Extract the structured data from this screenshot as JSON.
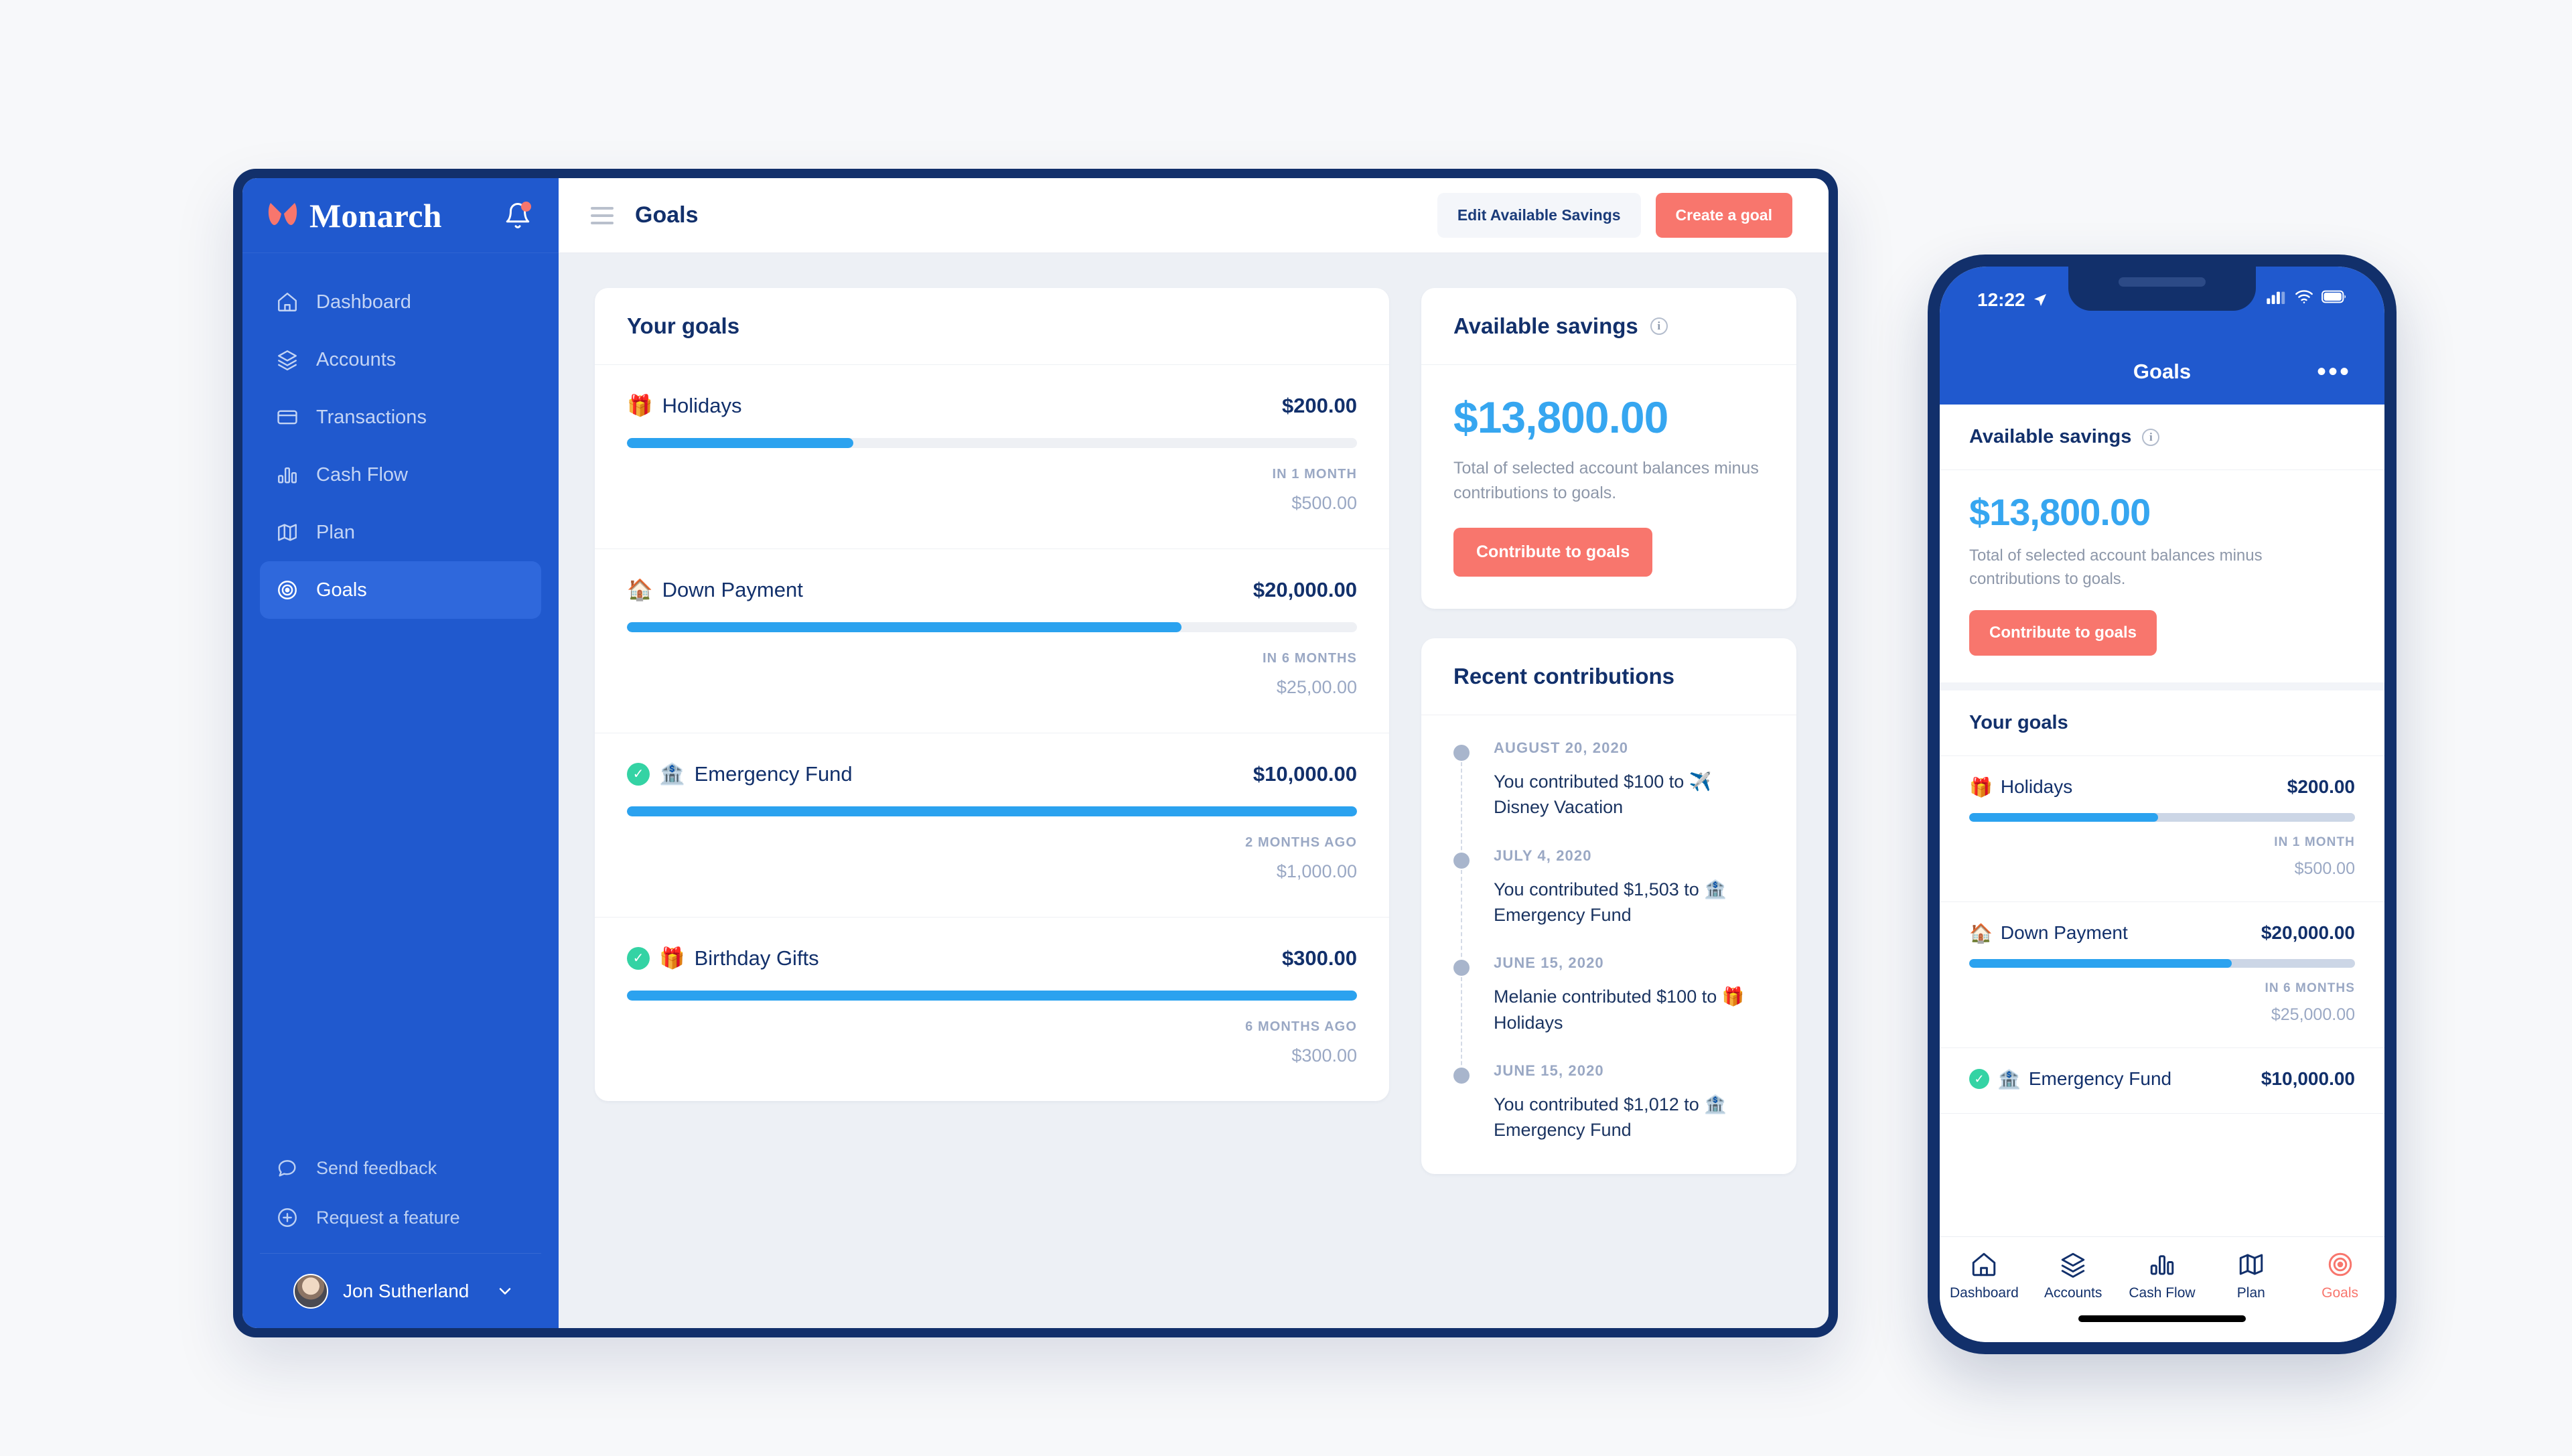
{
  "colors": {
    "brand_blue": "#2059ce",
    "dark_navy": "#12306b",
    "coral": "#f8766d",
    "progress_blue": "#2ba2ef",
    "success_green": "#34d3a4",
    "content_bg": "#edf0f5"
  },
  "sidebar": {
    "brand": "Monarch",
    "nav": [
      {
        "label": "Dashboard",
        "icon": "home-icon",
        "active": false
      },
      {
        "label": "Accounts",
        "icon": "layers-icon",
        "active": false
      },
      {
        "label": "Transactions",
        "icon": "card-icon",
        "active": false
      },
      {
        "label": "Cash Flow",
        "icon": "bar-chart-icon",
        "active": false
      },
      {
        "label": "Plan",
        "icon": "map-icon",
        "active": false
      },
      {
        "label": "Goals",
        "icon": "target-icon",
        "active": true
      }
    ],
    "secondary": [
      {
        "label": "Send feedback",
        "icon": "chat-bubble-icon"
      },
      {
        "label": "Request a feature",
        "icon": "plus-circle-icon"
      }
    ],
    "profile": {
      "name": "Jon Sutherland"
    }
  },
  "topbar": {
    "title": "Goals",
    "edit_savings_label": "Edit Available Savings",
    "create_goal_label": "Create a goal"
  },
  "goals_card": {
    "heading": "Your goals",
    "goals": [
      {
        "emoji": "🎁",
        "name": "Holidays",
        "amount": "$200.00",
        "progress_percent": 31,
        "when": "IN 1 MONTH",
        "target": "$500.00",
        "complete": false
      },
      {
        "emoji": "🏠",
        "name": "Down Payment",
        "amount": "$20,000.00",
        "progress_percent": 76,
        "when": "IN 6 MONTHS",
        "target": "$25,00.00",
        "complete": false
      },
      {
        "emoji": "🏦",
        "name": "Emergency Fund",
        "amount": "$10,000.00",
        "progress_percent": 100,
        "when": "2 MONTHS AGO",
        "target": "$1,000.00",
        "complete": true
      },
      {
        "emoji": "🎁",
        "name": "Birthday Gifts",
        "amount": "$300.00",
        "progress_percent": 100,
        "when": "6 MONTHS AGO",
        "target": "$300.00",
        "complete": true
      }
    ]
  },
  "available_savings": {
    "heading": "Available savings",
    "info_icon": "info-icon",
    "amount": "$13,800.00",
    "description": "Total of selected account balances minus contributions to goals.",
    "button_label": "Contribute to goals"
  },
  "recent_contributions": {
    "heading": "Recent contributions",
    "items": [
      {
        "date": "AUGUST 20, 2020",
        "text": "You contributed $100 to ✈️ Disney Vacation"
      },
      {
        "date": "JULY 4, 2020",
        "text": "You contributed $1,503 to 🏦 Emergency Fund"
      },
      {
        "date": "JUNE 15, 2020",
        "text": "Melanie contributed $100 to 🎁 Holidays"
      },
      {
        "date": "JUNE 15, 2020",
        "text": "You contributed $1,012 to 🏦 Emergency Fund"
      }
    ]
  },
  "phone": {
    "status": {
      "time": "12:22",
      "location_icon": "location-arrow-icon",
      "signal_icon": "signal-bars-icon",
      "wifi_icon": "wifi-icon",
      "battery_icon": "battery-icon"
    },
    "header": {
      "title": "Goals",
      "more_label": "•••"
    },
    "available_savings": {
      "heading": "Available savings",
      "amount": "$13,800.00",
      "description": "Total of selected account balances minus contributions to goals.",
      "button_label": "Contribute to goals"
    },
    "goals_heading": "Your goals",
    "goals": [
      {
        "emoji": "🎁",
        "name": "Holidays",
        "amount": "$200.00",
        "progress_percent": 49,
        "when": "IN 1 MONTH",
        "target": "$500.00",
        "complete": false
      },
      {
        "emoji": "🏠",
        "name": "Down Payment",
        "amount": "$20,000.00",
        "progress_percent": 68,
        "when": "IN 6 MONTHS",
        "target": "$25,000.00",
        "complete": false
      },
      {
        "emoji": "🏦",
        "name": "Emergency Fund",
        "amount": "$10,000.00",
        "progress_percent": 100,
        "when": "",
        "target": "",
        "complete": true
      }
    ],
    "tabs": [
      {
        "label": "Dashboard",
        "icon": "home-icon",
        "active": false
      },
      {
        "label": "Accounts",
        "icon": "layers-icon",
        "active": false
      },
      {
        "label": "Cash Flow",
        "icon": "bar-chart-icon",
        "active": false
      },
      {
        "label": "Plan",
        "icon": "map-icon",
        "active": false
      },
      {
        "label": "Goals",
        "icon": "target-icon",
        "active": true
      }
    ]
  }
}
